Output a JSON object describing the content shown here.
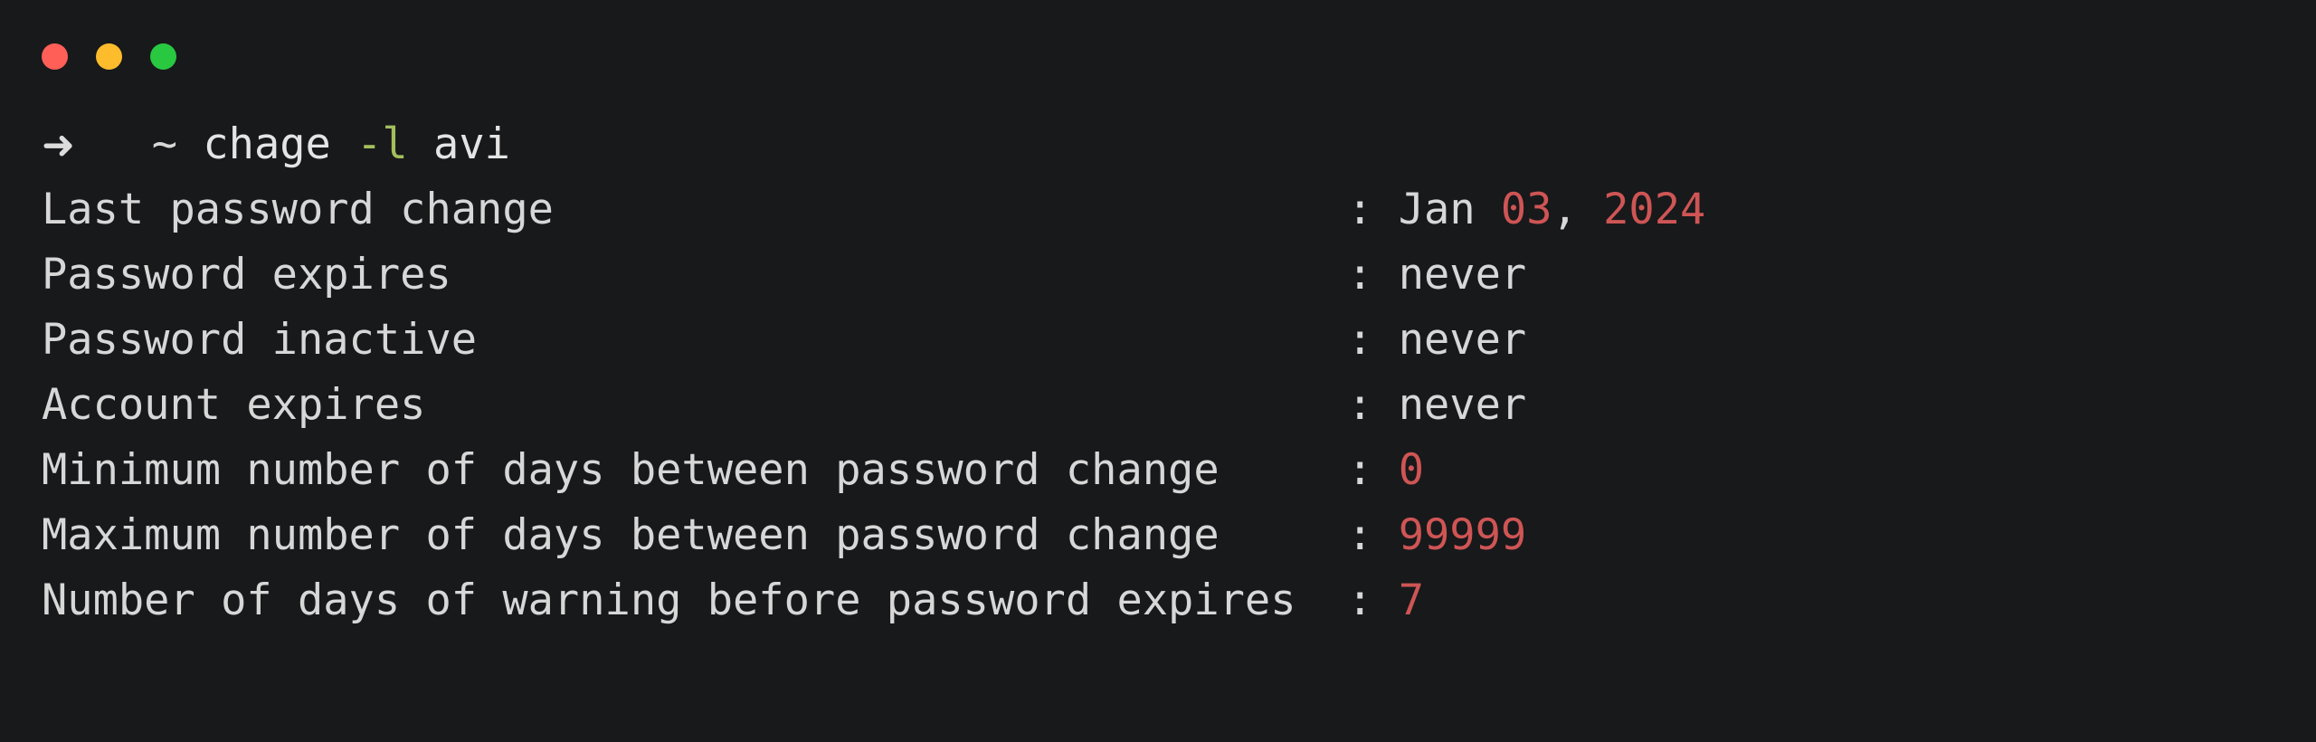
{
  "window": {
    "title": "chage -l avi",
    "background_color": "#18191b",
    "traffic_lights": [
      {
        "name": "close",
        "label": "Close",
        "color": "#ff5f56"
      },
      {
        "name": "minimize",
        "label": "Minimize",
        "color": "#fdbc2c"
      },
      {
        "name": "maximize",
        "label": "Maximize",
        "color": "#28c840"
      }
    ]
  },
  "colors": {
    "foreground": "#d7d7d7",
    "red": "#cf5555",
    "green": "#a3be5c",
    "background": "#18191b"
  },
  "prompt": {
    "arrow": "➜",
    "cwd": "~",
    "command": "chage",
    "flag": "-l",
    "argument": "avi",
    "full_command": "chage -l avi"
  },
  "output": {
    "label_column_width": 51,
    "separator": ":",
    "rows": [
      {
        "label": "Last password change",
        "value_text": "Jan 03, 2024",
        "value_parts": [
          {
            "text": "Jan",
            "style": "plain"
          },
          {
            "text": " ",
            "style": "plain"
          },
          {
            "text": "03",
            "style": "num"
          },
          {
            "text": ",",
            "style": "punct"
          },
          {
            "text": " ",
            "style": "plain"
          },
          {
            "text": "2024",
            "style": "num"
          }
        ]
      },
      {
        "label": "Password expires",
        "value_text": "never",
        "value_parts": [
          {
            "text": "never",
            "style": "plain"
          }
        ]
      },
      {
        "label": "Password inactive",
        "value_text": "never",
        "value_parts": [
          {
            "text": "never",
            "style": "plain"
          }
        ]
      },
      {
        "label": "Account expires",
        "value_text": "never",
        "value_parts": [
          {
            "text": "never",
            "style": "plain"
          }
        ]
      },
      {
        "label": "Minimum number of days between password change",
        "value_text": "0",
        "value_parts": [
          {
            "text": "0",
            "style": "num"
          }
        ]
      },
      {
        "label": "Maximum number of days between password change",
        "value_text": "99999",
        "value_parts": [
          {
            "text": "99999",
            "style": "num"
          }
        ]
      },
      {
        "label": "Number of days of warning before password expires",
        "value_text": "7",
        "value_parts": [
          {
            "text": "7",
            "style": "num"
          }
        ]
      }
    ]
  }
}
